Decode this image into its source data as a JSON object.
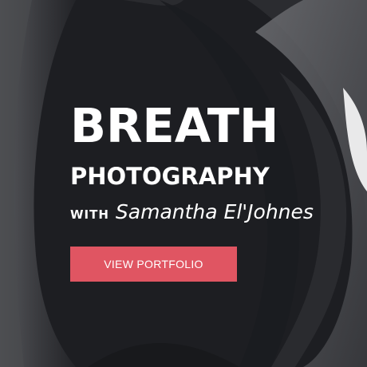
{
  "hero": {
    "title": "BREATH",
    "subtitle": "PHOTOGRAPHY",
    "with_label": "WITH",
    "author": "Samantha El'Johnes",
    "cta_label": "VIEW PORTFOLIO"
  },
  "colors": {
    "accent": "#e05562",
    "text": "#ffffff",
    "background": "#1c1d21"
  }
}
